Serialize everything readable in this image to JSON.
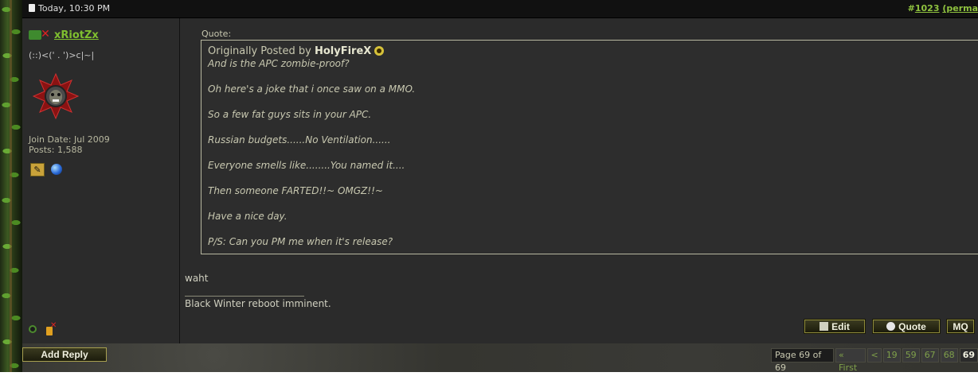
{
  "post": {
    "date": "Today, 10:30 PM",
    "number_prefix": "#",
    "number": "1023",
    "permalink_label": "(perma"
  },
  "user": {
    "name": "xRiotZx",
    "title": "(::)<(' . ')>c|~|",
    "join_date": "Join Date: Jul 2009",
    "posts": "Posts: 1,588",
    "group_icon_glyph": "✕"
  },
  "quote": {
    "label": "Quote:",
    "originally_posted_by": "Originally Posted by",
    "author": "HolyFireX",
    "lines": [
      "And is the APC zombie-proof?",
      "",
      "Oh here's a joke that i once saw on a MMO.",
      "",
      "So a few fat guys sits in your APC.",
      "",
      "Russian budgets......No Ventilation......",
      "",
      "Everyone smells like........You named it....",
      "",
      "Then someone FARTED!!~ OMGZ!!~",
      "",
      "Have a nice day.",
      "",
      "P/S: Can you PM me when it's release?"
    ]
  },
  "message": {
    "text": "waht",
    "signature": "Black Winter reboot imminent."
  },
  "buttons": {
    "edit": "Edit",
    "quote": "Quote",
    "mq": "MQ",
    "add_reply": "Add Reply"
  },
  "pagination": {
    "label": "Page 69 of 69",
    "first": "« First",
    "prev": "<",
    "pages": [
      "19",
      "59",
      "67",
      "68",
      "69"
    ]
  },
  "colors": {
    "accent": "#7fbf2f",
    "post_bg": "#2b2b2b",
    "header_bg": "#111111"
  }
}
